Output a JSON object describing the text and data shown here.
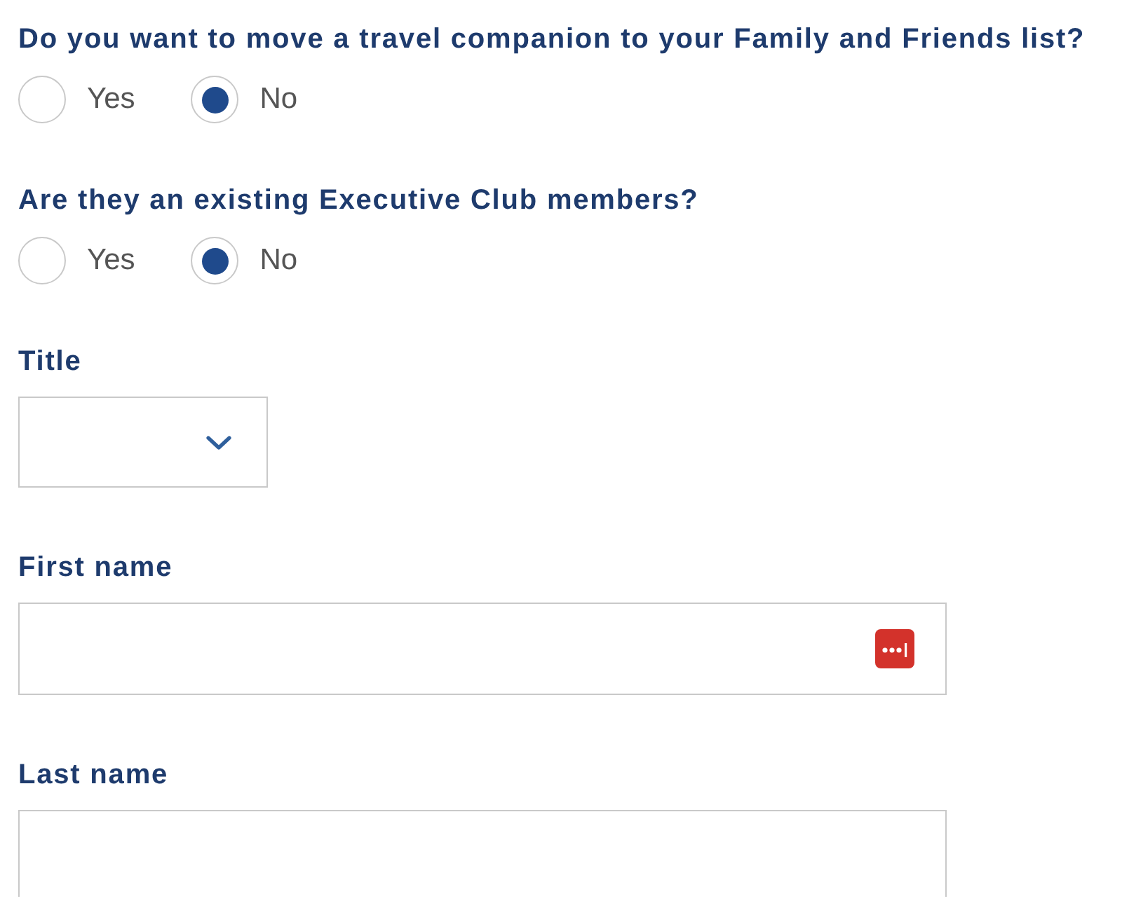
{
  "questions": [
    {
      "label": "Do you want to move a travel companion to your Family and Friends list?",
      "options": [
        {
          "label": "Yes",
          "selected": false
        },
        {
          "label": "No",
          "selected": true
        }
      ]
    },
    {
      "label": "Are they an existing Executive Club members?",
      "options": [
        {
          "label": "Yes",
          "selected": false
        },
        {
          "label": "No",
          "selected": true
        }
      ]
    }
  ],
  "fields": [
    {
      "kind": "select",
      "label": "Title"
    },
    {
      "kind": "text",
      "label": "First name",
      "autofill_icon": true
    },
    {
      "kind": "text",
      "label": "Last name",
      "autofill_icon": false
    }
  ]
}
